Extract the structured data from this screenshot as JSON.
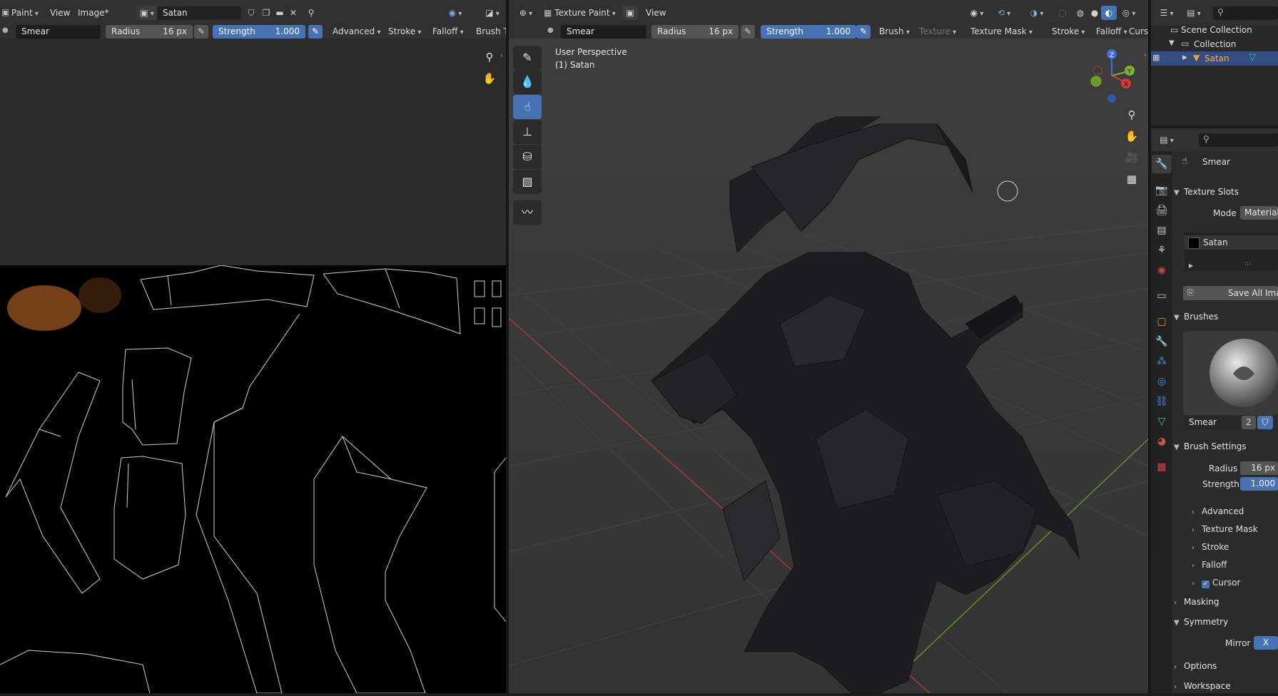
{
  "image_editor": {
    "mode": "Paint",
    "menus": [
      "View",
      "Image*"
    ],
    "image_name": "Satan",
    "brush_name": "Smear",
    "radius_label": "Radius",
    "radius_value": "16 px",
    "strength_label": "Strength",
    "strength_value": "1.000",
    "dropdowns": [
      "Advanced",
      "Stroke",
      "Falloff",
      "Brush Ti"
    ]
  },
  "viewport": {
    "mode": "Texture Paint",
    "menu": "View",
    "brush_name": "Smear",
    "radius_label": "Radius",
    "radius_value": "16 px",
    "strength_label": "Strength",
    "strength_value": "1.000",
    "dropdowns": [
      "Brush",
      "Texture",
      "Texture Mask",
      "Stroke",
      "Falloff",
      "Curs"
    ],
    "perspective": "User Perspective",
    "object_label": "(1) Satan",
    "gizmo": {
      "x": "X",
      "y": "Y",
      "z": "Z"
    }
  },
  "outliner": {
    "scene_collection": "Scene Collection",
    "collection": "Collection",
    "object": "Satan"
  },
  "properties": {
    "brush_title": "Smear",
    "texture_slots": {
      "header": "Texture Slots",
      "mode_label": "Mode",
      "mode_value": "Material",
      "slot": "Satan",
      "save_button": "Save All Imag",
      "dots": ":::"
    },
    "brushes": {
      "header": "Brushes",
      "brush_name": "Smear",
      "users": "2"
    },
    "brush_settings": {
      "header": "Brush Settings",
      "radius_label": "Radius",
      "radius_value": "16 px",
      "strength_label": "Strength",
      "strength_value": "1.000",
      "subpanels": [
        "Advanced",
        "Texture Mask",
        "Stroke",
        "Falloff",
        "Cursor"
      ]
    },
    "masking": "Masking",
    "symmetry": {
      "header": "Symmetry",
      "mirror_label": "Mirror",
      "mirror_x": "X"
    },
    "options": "Options",
    "workspace": "Workspace"
  },
  "colors": {
    "accent": "#4772b3",
    "header": "#303030",
    "viewport_bg": "#3d3d3d"
  }
}
